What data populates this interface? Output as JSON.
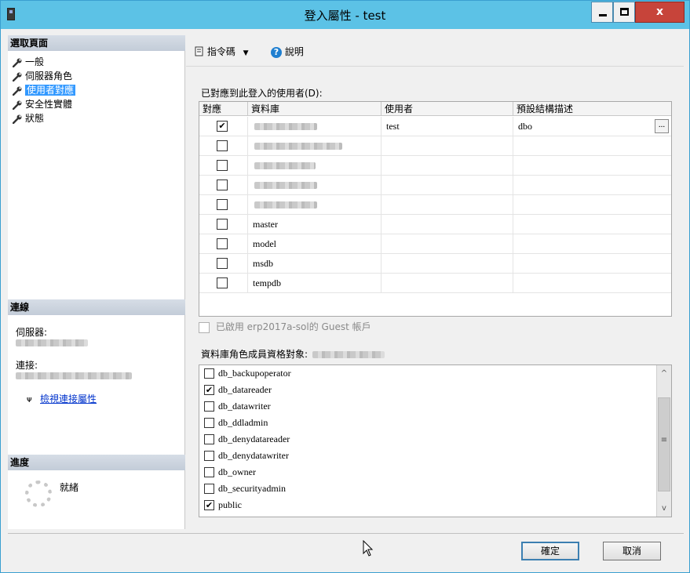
{
  "window": {
    "title": "登入屬性 - test"
  },
  "titlebar": {
    "close_label": "x"
  },
  "left": {
    "select_page_header": "選取頁面",
    "nav_items": [
      {
        "label": "一般",
        "selected": false
      },
      {
        "label": "伺服器角色",
        "selected": false
      },
      {
        "label": "使用者對應",
        "selected": true
      },
      {
        "label": "安全性實體",
        "selected": false
      },
      {
        "label": "狀態",
        "selected": false
      }
    ],
    "connection_header": "連線",
    "server_label": "伺服器:",
    "connection_label": "連接:",
    "view_connection_link": "檢視連接屬性",
    "progress_header": "進度",
    "progress_status": "就緒"
  },
  "toolbar": {
    "script_label": "指令碼",
    "script_dropdown": "▼",
    "help_label": "說明"
  },
  "mapping": {
    "caption": "已對應到此登入的使用者(D):",
    "columns": [
      "對應",
      "資料庫",
      "使用者",
      "預設結構描述"
    ],
    "rows": [
      {
        "checked": true,
        "database": "",
        "user": "test",
        "schema": "dbo"
      },
      {
        "checked": false,
        "database": "",
        "user": "",
        "schema": ""
      },
      {
        "checked": false,
        "database": "",
        "user": "",
        "schema": ""
      },
      {
        "checked": false,
        "database": "",
        "user": "",
        "schema": ""
      },
      {
        "checked": false,
        "database": "",
        "user": "",
        "schema": ""
      },
      {
        "checked": false,
        "database": "master",
        "user": "",
        "schema": ""
      },
      {
        "checked": false,
        "database": "model",
        "user": "",
        "schema": ""
      },
      {
        "checked": false,
        "database": "msdb",
        "user": "",
        "schema": ""
      },
      {
        "checked": false,
        "database": "tempdb",
        "user": "",
        "schema": ""
      }
    ],
    "browse_button": "..."
  },
  "guest": {
    "label": "已啟用 erp2017a-sol的 Guest 帳戶"
  },
  "roles": {
    "caption": "資料庫角色成員資格對象:",
    "items": [
      {
        "name": "db_backupoperator",
        "checked": false
      },
      {
        "name": "db_datareader",
        "checked": true
      },
      {
        "name": "db_datawriter",
        "checked": false
      },
      {
        "name": "db_ddladmin",
        "checked": false
      },
      {
        "name": "db_denydatareader",
        "checked": false
      },
      {
        "name": "db_denydatawriter",
        "checked": false
      },
      {
        "name": "db_owner",
        "checked": false
      },
      {
        "name": "db_securityadmin",
        "checked": false
      },
      {
        "name": "public",
        "checked": true
      }
    ]
  },
  "footer": {
    "ok_label": "確定",
    "cancel_label": "取消"
  },
  "colors": {
    "titlebar": "#5cc2e6",
    "selection": "#3399ff",
    "link": "#0033cc",
    "close": "#c7443a"
  }
}
